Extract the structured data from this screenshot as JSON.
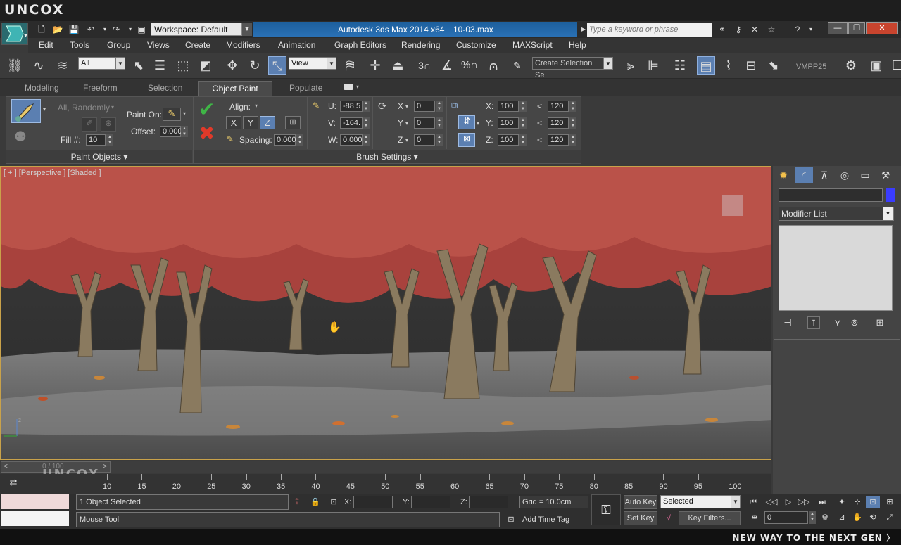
{
  "brand": "UNCOX",
  "workspace": {
    "label": "Workspace: Default"
  },
  "window_title": {
    "app": "Autodesk 3ds Max  2014 x64",
    "file": "10-03.max"
  },
  "search": {
    "placeholder": "Type a keyword or phrase"
  },
  "menu": [
    "Edit",
    "Tools",
    "Group",
    "Views",
    "Create",
    "Modifiers",
    "Animation",
    "Graph Editors",
    "Rendering",
    "Customize",
    "MAXScript",
    "Help"
  ],
  "toolbar": {
    "selection_filter": "All",
    "ref_coord": "View",
    "selection_set": "Create Selection Se",
    "render_label": "VMPP25"
  },
  "ribbon": {
    "tabs": [
      "Modeling",
      "Freeform",
      "Selection",
      "Object Paint",
      "Populate"
    ],
    "active_tab": "Object Paint",
    "paint_objects": {
      "random_label": "All, Randomly",
      "fill_label": "Fill #:",
      "fill_value": "10",
      "paint_on_label": "Paint On:",
      "offset_label": "Offset:",
      "offset_value": "0.000",
      "footer": "Paint Objects"
    },
    "align": {
      "label": "Align:",
      "axes": [
        "X",
        "Y",
        "Z"
      ],
      "active_axis": "Z",
      "spacing_label": "Spacing:",
      "spacing_value": "0.000"
    },
    "brush": {
      "u_label": "U:",
      "u_value": "-88.5",
      "v_label": "V:",
      "v_value": "-164.",
      "w_label": "W:",
      "w_value": "0.000",
      "rx_label": "X",
      "rx_value": "0",
      "ry_label": "Y",
      "ry_value": "0",
      "rz_label": "Z",
      "rz_value": "0",
      "sx_label": "X:",
      "sx_value": "100",
      "sy_label": "Y:",
      "sy_value": "100",
      "sz_label": "Z:",
      "sz_value": "100",
      "lt": "<",
      "mx_value": "120",
      "my_value": "120",
      "mz_value": "120",
      "footer": "Brush Settings"
    }
  },
  "viewport": {
    "label": "[ + ] [Perspective ] [Shaded ]"
  },
  "command_panel": {
    "modifier_list": "Modifier List"
  },
  "time_slider": {
    "frame_display": "0 / 100",
    "prev": "<",
    "next": ">"
  },
  "timeline_ticks": [
    "10",
    "15",
    "20",
    "25",
    "30",
    "35",
    "40",
    "45",
    "50",
    "55",
    "60",
    "65",
    "70",
    "75",
    "80",
    "85",
    "90",
    "95",
    "100"
  ],
  "status": {
    "selected": "1 Object Selected",
    "prompt": "Mouse Tool",
    "x_label": "X:",
    "y_label": "Y:",
    "z_label": "Z:",
    "grid": "Grid = 10.0cm",
    "add_time_tag": "Add Time Tag",
    "auto_key": "Auto Key",
    "set_key": "Set Key",
    "key_mode": "Selected",
    "key_filters": "Key Filters...",
    "frame": "0"
  },
  "tagline": "NEW WAY TO THE NEXT GEN 〉"
}
